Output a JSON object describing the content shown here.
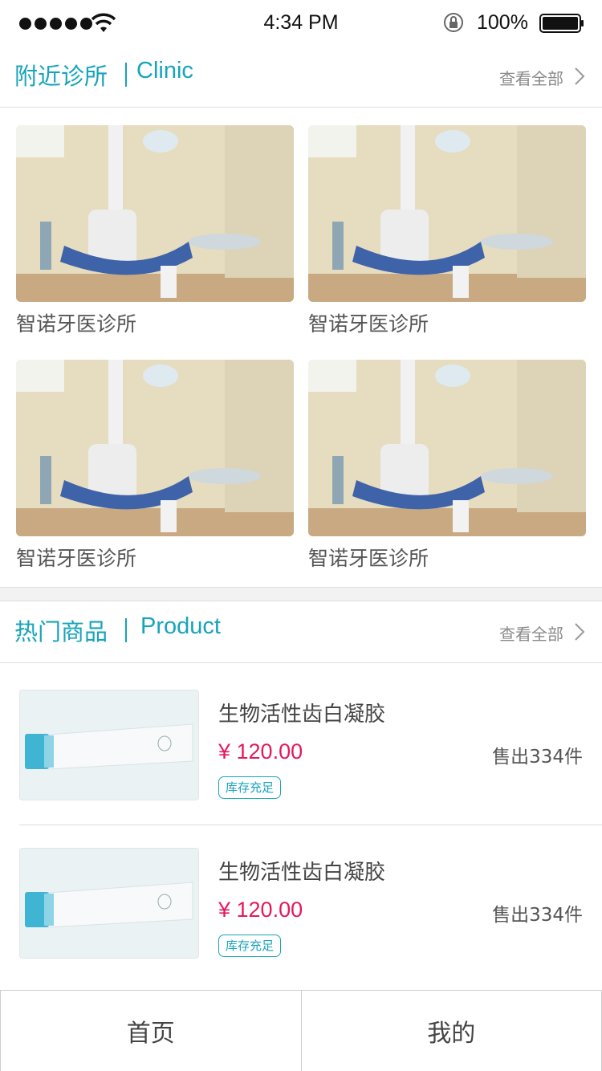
{
  "status_bar": {
    "time": "4:34 PM",
    "battery_percent": "100%",
    "signal_icon": "signal-dots-icon",
    "wifi_icon": "wifi-icon",
    "lock_icon": "rotation-lock-icon",
    "battery_icon": "battery-icon"
  },
  "clinic_section": {
    "title_cn": "附近诊所",
    "title_en": "Clinic",
    "view_all": "查看全部",
    "clinics": [
      {
        "name": "智诺牙医诊所"
      },
      {
        "name": "智诺牙医诊所"
      },
      {
        "name": "智诺牙医诊所"
      },
      {
        "name": "智诺牙医诊所"
      }
    ]
  },
  "product_section": {
    "title_cn": "热门商品",
    "title_en": "Product",
    "view_all": "查看全部",
    "products": [
      {
        "name": "生物活性齿白凝胶",
        "price": "¥ 120.00",
        "sold": "售出334件",
        "stock": "库存充足"
      },
      {
        "name": "生物活性齿白凝胶",
        "price": "¥ 120.00",
        "sold": "售出334件",
        "stock": "库存充足"
      }
    ]
  },
  "tab_bar": {
    "tabs": [
      {
        "label": "首页"
      },
      {
        "label": "我的"
      }
    ]
  },
  "colors": {
    "accent": "#17a4bb",
    "price": "#e5195a"
  }
}
